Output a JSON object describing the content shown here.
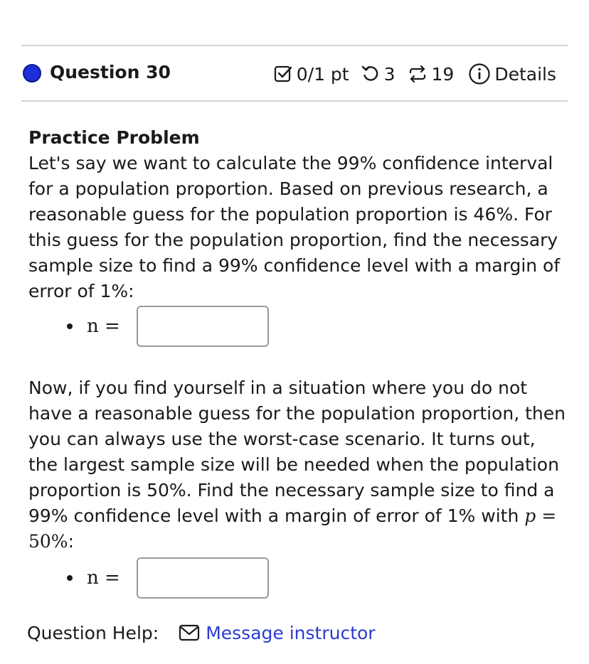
{
  "question": {
    "title": "Question 30",
    "score": "0/1 pt",
    "retries": "3",
    "versions": "19",
    "details_label": "Details"
  },
  "problem": {
    "subtitle": "Practice Problem",
    "intro": "Let's say we want to calculate the 99% confidence interval for a population proportion.  Based on previous research, a reasonable guess for the population proportion is 46%.  For this guess for the population proportion, find the necessary sample size to find a 99% confidence level with a margin of error of 1%:",
    "answer1_label": "n =",
    "answer1_value": "",
    "part2_text": "Now, if you find yourself in a situation where you do not have a reasonable guess for the population proportion, then you can always use the worst-case scenario.  It turns out, the largest sample size will be needed when the population proportion is 50%.  Find the necessary sample size to find a 99% confidence level with a margin of error of 1% with",
    "part2_p": "p",
    "part2_eq": " = 50%",
    "part2_end": ":",
    "answer2_label": "n =",
    "answer2_value": ""
  },
  "help": {
    "label": "Question Help:",
    "message_link": "Message instructor"
  },
  "colors": {
    "status_dot": "#1d2fd8",
    "link": "#2b3bd1",
    "divider": "#d4d4d4"
  },
  "icons": {
    "score": "checkbox-icon",
    "retries": "retry-icon",
    "versions": "versions-icon",
    "details": "info-icon",
    "message": "envelope-icon"
  }
}
